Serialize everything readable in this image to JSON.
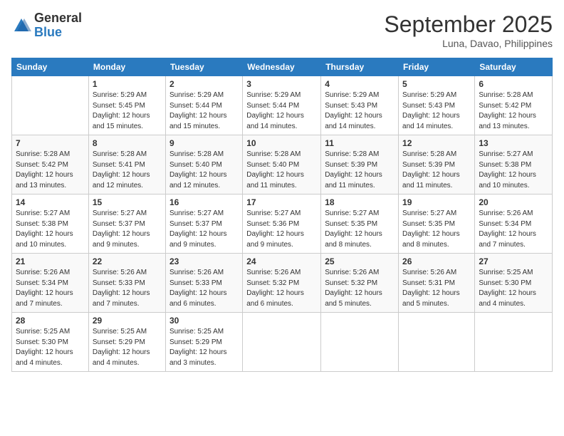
{
  "header": {
    "logo": {
      "general": "General",
      "blue": "Blue"
    },
    "month_title": "September 2025",
    "location": "Luna, Davao, Philippines"
  },
  "days_of_week": [
    "Sunday",
    "Monday",
    "Tuesday",
    "Wednesday",
    "Thursday",
    "Friday",
    "Saturday"
  ],
  "weeks": [
    [
      {
        "day": "",
        "info": ""
      },
      {
        "day": "1",
        "info": "Sunrise: 5:29 AM\nSunset: 5:45 PM\nDaylight: 12 hours\nand 15 minutes."
      },
      {
        "day": "2",
        "info": "Sunrise: 5:29 AM\nSunset: 5:44 PM\nDaylight: 12 hours\nand 15 minutes."
      },
      {
        "day": "3",
        "info": "Sunrise: 5:29 AM\nSunset: 5:44 PM\nDaylight: 12 hours\nand 14 minutes."
      },
      {
        "day": "4",
        "info": "Sunrise: 5:29 AM\nSunset: 5:43 PM\nDaylight: 12 hours\nand 14 minutes."
      },
      {
        "day": "5",
        "info": "Sunrise: 5:29 AM\nSunset: 5:43 PM\nDaylight: 12 hours\nand 14 minutes."
      },
      {
        "day": "6",
        "info": "Sunrise: 5:28 AM\nSunset: 5:42 PM\nDaylight: 12 hours\nand 13 minutes."
      }
    ],
    [
      {
        "day": "7",
        "info": "Sunrise: 5:28 AM\nSunset: 5:42 PM\nDaylight: 12 hours\nand 13 minutes."
      },
      {
        "day": "8",
        "info": "Sunrise: 5:28 AM\nSunset: 5:41 PM\nDaylight: 12 hours\nand 12 minutes."
      },
      {
        "day": "9",
        "info": "Sunrise: 5:28 AM\nSunset: 5:40 PM\nDaylight: 12 hours\nand 12 minutes."
      },
      {
        "day": "10",
        "info": "Sunrise: 5:28 AM\nSunset: 5:40 PM\nDaylight: 12 hours\nand 11 minutes."
      },
      {
        "day": "11",
        "info": "Sunrise: 5:28 AM\nSunset: 5:39 PM\nDaylight: 12 hours\nand 11 minutes."
      },
      {
        "day": "12",
        "info": "Sunrise: 5:28 AM\nSunset: 5:39 PM\nDaylight: 12 hours\nand 11 minutes."
      },
      {
        "day": "13",
        "info": "Sunrise: 5:27 AM\nSunset: 5:38 PM\nDaylight: 12 hours\nand 10 minutes."
      }
    ],
    [
      {
        "day": "14",
        "info": "Sunrise: 5:27 AM\nSunset: 5:38 PM\nDaylight: 12 hours\nand 10 minutes."
      },
      {
        "day": "15",
        "info": "Sunrise: 5:27 AM\nSunset: 5:37 PM\nDaylight: 12 hours\nand 9 minutes."
      },
      {
        "day": "16",
        "info": "Sunrise: 5:27 AM\nSunset: 5:37 PM\nDaylight: 12 hours\nand 9 minutes."
      },
      {
        "day": "17",
        "info": "Sunrise: 5:27 AM\nSunset: 5:36 PM\nDaylight: 12 hours\nand 9 minutes."
      },
      {
        "day": "18",
        "info": "Sunrise: 5:27 AM\nSunset: 5:35 PM\nDaylight: 12 hours\nand 8 minutes."
      },
      {
        "day": "19",
        "info": "Sunrise: 5:27 AM\nSunset: 5:35 PM\nDaylight: 12 hours\nand 8 minutes."
      },
      {
        "day": "20",
        "info": "Sunrise: 5:26 AM\nSunset: 5:34 PM\nDaylight: 12 hours\nand 7 minutes."
      }
    ],
    [
      {
        "day": "21",
        "info": "Sunrise: 5:26 AM\nSunset: 5:34 PM\nDaylight: 12 hours\nand 7 minutes."
      },
      {
        "day": "22",
        "info": "Sunrise: 5:26 AM\nSunset: 5:33 PM\nDaylight: 12 hours\nand 7 minutes."
      },
      {
        "day": "23",
        "info": "Sunrise: 5:26 AM\nSunset: 5:33 PM\nDaylight: 12 hours\nand 6 minutes."
      },
      {
        "day": "24",
        "info": "Sunrise: 5:26 AM\nSunset: 5:32 PM\nDaylight: 12 hours\nand 6 minutes."
      },
      {
        "day": "25",
        "info": "Sunrise: 5:26 AM\nSunset: 5:32 PM\nDaylight: 12 hours\nand 5 minutes."
      },
      {
        "day": "26",
        "info": "Sunrise: 5:26 AM\nSunset: 5:31 PM\nDaylight: 12 hours\nand 5 minutes."
      },
      {
        "day": "27",
        "info": "Sunrise: 5:25 AM\nSunset: 5:30 PM\nDaylight: 12 hours\nand 4 minutes."
      }
    ],
    [
      {
        "day": "28",
        "info": "Sunrise: 5:25 AM\nSunset: 5:30 PM\nDaylight: 12 hours\nand 4 minutes."
      },
      {
        "day": "29",
        "info": "Sunrise: 5:25 AM\nSunset: 5:29 PM\nDaylight: 12 hours\nand 4 minutes."
      },
      {
        "day": "30",
        "info": "Sunrise: 5:25 AM\nSunset: 5:29 PM\nDaylight: 12 hours\nand 3 minutes."
      },
      {
        "day": "",
        "info": ""
      },
      {
        "day": "",
        "info": ""
      },
      {
        "day": "",
        "info": ""
      },
      {
        "day": "",
        "info": ""
      }
    ]
  ]
}
